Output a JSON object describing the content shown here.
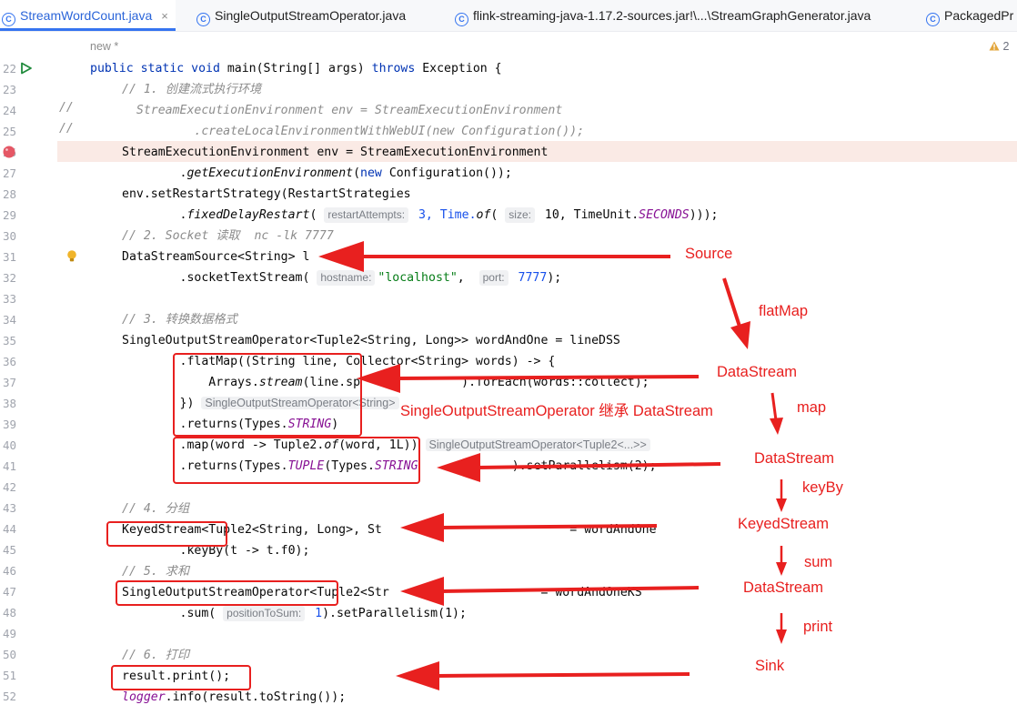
{
  "tabs": [
    {
      "label": "StreamWordCount.java",
      "active": true,
      "closable": true
    },
    {
      "label": "SingleOutputStreamOperator.java",
      "active": false,
      "closable": false
    },
    {
      "label": "flink-streaming-java-1.17.2-sources.jar!\\...\\StreamGraphGenerator.java",
      "active": false,
      "closable": false
    },
    {
      "label": "PackagedPr",
      "active": false,
      "closable": false
    }
  ],
  "tab_close_glyph": "×",
  "class_icon_glyph": "C",
  "editor": {
    "author_hint": "new *",
    "warnings_count": "2",
    "warning_icon": "warning-triangle-icon",
    "run_icon": "run-gutter-icon",
    "breakpoint_icon": "breakpoint-icon",
    "intention_icon": "lightbulb-icon",
    "line_numbers": [
      "22",
      "23",
      "24",
      "25",
      "26",
      "27",
      "28",
      "29",
      "30",
      "31",
      "32",
      "33",
      "34",
      "35",
      "36",
      "37",
      "38",
      "39",
      "40",
      "41",
      "42",
      "43",
      "44",
      "45",
      "46",
      "47",
      "48",
      "49",
      "50",
      "51",
      "52"
    ],
    "fold_marks": {
      "24": "//",
      "25": "//"
    },
    "code": {
      "l22": {
        "kw": "public static void",
        "rest": " main(String[] args) ",
        "kw2": "throws",
        "rest2": " Exception {"
      },
      "l23": "// 1. 创建流式执行环境",
      "l24": "  StreamExecutionEnvironment env = StreamExecutionEnvironment",
      "l25": "          .createLocalEnvironmentWithWebUI(new Configuration());",
      "l26": "StreamExecutionEnvironment env = StreamExecutionEnvironment",
      "l27": {
        "a": "        .",
        "b": "getExecutionEnvironment",
        "c": "(",
        "kw": "new",
        "d": " Configuration());"
      },
      "l28": "env.setRestartStrategy(RestartStrategies",
      "l29": {
        "a": "        .",
        "b": "fixedDelayRestart",
        "c": "( ",
        "h1": "restartAttempts:",
        "d": " 3, Time.",
        "e": "of",
        "f": "( ",
        "h2": "size:",
        "g": " 10, TimeUnit.",
        "k": "SECONDS",
        "m": ")));"
      },
      "l30": "// 2. Socket 读取  nc -lk 7777",
      "l31": "DataStreamSource<String> l",
      "l32": {
        "a": "        .socketTextStream( ",
        "h1": "hostname:",
        "s": "\"localhost\"",
        "b": ",  ",
        "h2": "port:",
        "n": " 7777",
        "c": ");"
      },
      "l34": "// 3. 转换数据格式",
      "l35": "SingleOutputStreamOperator<Tuple2<String, Long>> wordAndOne = lineDSS",
      "l36": "        .flatMap((String line, Collector<String> words) -> {",
      "l37": {
        "a": "            Arrays.",
        "b": "stream",
        "c": "(line.sp",
        "d": "              ).forEach(words::collect);"
      },
      "l38": {
        "a": "        })",
        "hint": "SingleOutputStreamOperator<String>"
      },
      "l39": {
        "a": "        .returns(Types.",
        "b": "STRING",
        "c": ")"
      },
      "l40": {
        "a": "        .map(word -> Tuple2.",
        "b": "of",
        "c": "(word, 1L))",
        "hint": "SingleOutputStreamOperator<Tuple2<...>>"
      },
      "l41": {
        "a": "        .returns(Types.",
        "b": "TUPLE",
        "c": "(Types.",
        "d": "STRING",
        "e": "             ).setParallelism(2);"
      },
      "l43": "// 4. 分组",
      "l44": "KeyedStream<Tuple2<String, Long>, St                          = wordAndOne",
      "l45": "        .keyBy(t -> t.f0);",
      "l46": "// 5. 求和",
      "l47": "SingleOutputStreamOperator<Tuple2<Str                     = wordAndOneKS",
      "l48": {
        "a": "        .sum( ",
        "h": "positionToSum:",
        "n": " 1",
        ".": ").setParallelism(1);"
      },
      "l50": "// 6. 打印",
      "l51": "result.print();",
      "l52": {
        "a": "logger",
        "b": ".info(result.toString());"
      }
    }
  },
  "annotations": {
    "source": "Source",
    "flatmap": "flatMap",
    "datastream1": "DataStream",
    "inherit": "SingleOutputStreamOperator 继承 DataStream",
    "map": "map",
    "datastream2": "DataStream",
    "keyby": "keyBy",
    "keyedstream": "KeyedStream",
    "sum": "sum",
    "datastream3": "DataStream",
    "print": "print",
    "sink": "Sink"
  },
  "colors": {
    "annotation": "#e8201f",
    "keyword": "#0033b3",
    "comment": "#8c8c8c",
    "string": "#067d17",
    "number": "#1750eb",
    "breakpoint_line": "#faeae5",
    "active_tab": "#3574f0"
  }
}
